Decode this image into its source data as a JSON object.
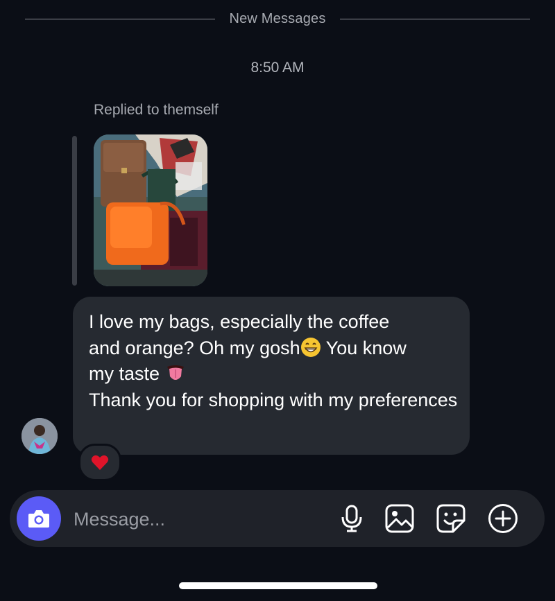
{
  "divider": {
    "label": "New Messages"
  },
  "timestamp": "8:50 AM",
  "reply": {
    "label": "Replied to themself"
  },
  "message": {
    "line_1": "I love my bags, especially the coffee",
    "line_2a": "and orange? Oh my gosh",
    "line_2b": " You know",
    "line_3": "my taste ",
    "line_4": "Thank you for shopping with my preferences",
    "emojis": [
      "grinning-face-emoji",
      "tongue-emoji"
    ]
  },
  "reaction": {
    "icon": "heart-icon",
    "color": "#e0142a"
  },
  "composer": {
    "placeholder": "Message...",
    "value": "",
    "accent": "#5b5bf6",
    "icons": [
      "camera-icon",
      "microphone-icon",
      "gallery-icon",
      "sticker-icon",
      "add-icon"
    ]
  }
}
